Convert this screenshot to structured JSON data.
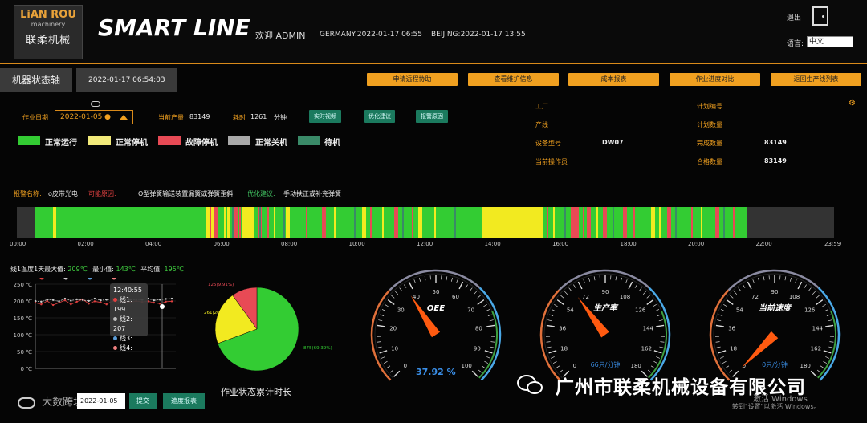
{
  "header": {
    "logo_line1": "LiAN ROU",
    "logo_line2": "machinery",
    "logo_line3": "联柔机械",
    "brand": "SMART LINE",
    "welcome": "欢迎 ADMIN",
    "germany_time": "GERMANY:2022-01-17 06:55",
    "beijing_time": "BEIJING:2022-01-17 13:55",
    "exit_label": "退出",
    "language_label": "语言:",
    "language_value": "中文"
  },
  "toolbar": {
    "tab_label": "机器状态轴",
    "current_time": "2022-01-17 06:54:03",
    "buttons": [
      "申请远程协助",
      "查看维护信息",
      "成本报表",
      "作业进度对比",
      "返回生产线列表"
    ]
  },
  "controls": {
    "date_label": "作业日期",
    "date_value": "2022-01-05 ●",
    "output_label": "当前产量",
    "output_value": "83149",
    "time_label": "耗时",
    "time_value": "1261",
    "time_unit": "分钟",
    "btn_realtime": "实时视频",
    "btn_optimize": "优化建议",
    "btn_alarm": "报警原因"
  },
  "legend": [
    {
      "label": "正常运行",
      "color": "#33cc33"
    },
    {
      "label": "正常停机",
      "color": "#f2ea7a"
    },
    {
      "label": "故障停机",
      "color": "#e84a55"
    },
    {
      "label": "正常关机",
      "color": "#a9a9a9"
    },
    {
      "label": "待机",
      "color": "#3a8a68"
    }
  ],
  "machine_info": {
    "factory_label": "工厂",
    "line_label": "产线",
    "model_label": "设备型号",
    "model_value": "DW07",
    "operator_label": "当前操作员",
    "plan_no_label": "计划编号",
    "plan_qty_label": "计划数量",
    "done_qty_label": "完成数量",
    "done_qty_value": "83149",
    "pass_qty_label": "合格数量",
    "pass_qty_value": "83149"
  },
  "alarm": {
    "name_label": "报警名称:",
    "name_value": "o皮带光电",
    "cause_label": "可能原因:",
    "cause_value": "O型弹簧输送装置漏簧或弹簧歪斜",
    "advice_label": "优化建议:",
    "advice_value": "手动扶正或补充弹簧"
  },
  "timeline": {
    "ticks": [
      "00:00",
      "02:00",
      "04:00",
      "06:00",
      "08:00",
      "10:00",
      "12:00",
      "14:00",
      "16:00",
      "18:00",
      "20:00",
      "22:00",
      "23:59"
    ]
  },
  "temperature": {
    "title_prefix": "线1温度1天最大值:",
    "max": "209℃",
    "min_label": "最小值:",
    "min": "143℃",
    "avg_label": "平均值:",
    "avg": "195℃",
    "y_ticks": [
      "250 ℃",
      "200 ℃",
      "150 ℃",
      "100 ℃",
      "50 ℃",
      "0 ℃"
    ],
    "tooltip_time": "12:40:55",
    "tooltip_lines": [
      "线1: 199",
      "线2: 207",
      "线3:",
      "线4:"
    ],
    "tooltip_colors": [
      "#e04040",
      "#bbbbbb",
      "#5b9bd5",
      "#f08080"
    ]
  },
  "pie": {
    "title": "作业状态累计时长",
    "label_red": "125(9.91%)",
    "label_yellow": "261(20.70%)",
    "label_green": "875(69.39%)"
  },
  "gauges": {
    "oee_title": "OEE",
    "oee_value": "37.92 %",
    "prod_title": "生产率",
    "prod_unit": "66只/分钟",
    "speed_title": "当前速度",
    "speed_unit": "0只/分钟",
    "oee_ticks": [
      "0",
      "10",
      "20",
      "30",
      "40",
      "50",
      "60",
      "70",
      "80",
      "90",
      "100"
    ],
    "prod_ticks": [
      "0",
      "18",
      "36",
      "54",
      "72",
      "90",
      "108",
      "126",
      "144",
      "162",
      "180"
    ]
  },
  "footer": {
    "date_value": "2022-01-05",
    "btn_submit": "提交",
    "btn_report": "速度报表",
    "watermark": "大数跨境",
    "company": "广州市联柔机械设备有限公司",
    "win_activate": "激活 Windows",
    "win_hint": "转到\"设置\"以激活 Windows。"
  },
  "chart_data": [
    {
      "type": "pie",
      "title": "作业状态累计时长",
      "categories": [
        "正常运行",
        "正常停机",
        "故障停机"
      ],
      "values": [
        875,
        261,
        125
      ],
      "colors": [
        "#33cc33",
        "#f2ea20",
        "#e84a55"
      ]
    },
    {
      "type": "line",
      "ylim": [
        0,
        250
      ],
      "series": [
        {
          "name": "线1",
          "values": [
            195,
            190,
            200,
            188,
            195,
            202,
            190,
            198,
            205,
            192,
            199,
            196,
            190,
            200,
            194,
            199,
            196,
            200,
            197,
            199,
            195,
            192,
            198,
            199
          ]
        },
        {
          "name": "线2",
          "values": [
            200,
            198,
            204,
            203,
            199,
            207,
            201,
            205,
            203,
            200,
            207,
            202,
            204,
            206,
            201,
            207,
            203,
            205,
            204,
            207,
            202,
            204,
            206,
            207
          ]
        }
      ]
    }
  ]
}
